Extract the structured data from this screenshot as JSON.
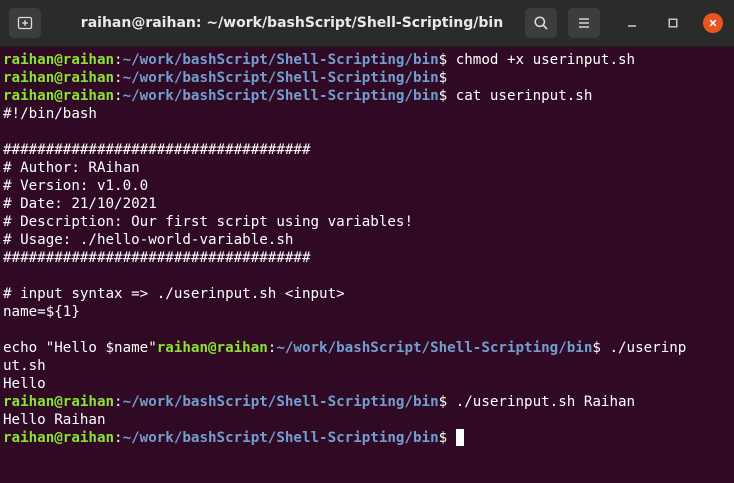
{
  "window": {
    "title": "raihan@raihan: ~/work/bashScript/Shell-Scripting/bin"
  },
  "prompt": {
    "user_host": "raihan@raihan",
    "colon": ":",
    "path": "~/work/bashScript/Shell-Scripting/bin",
    "symbol": "$"
  },
  "lines": [
    {
      "type": "prompt",
      "cmd": " chmod +x userinput.sh"
    },
    {
      "type": "prompt",
      "cmd": ""
    },
    {
      "type": "prompt",
      "cmd": " cat userinput.sh"
    },
    {
      "type": "text",
      "text": "#!/bin/bash"
    },
    {
      "type": "text",
      "text": ""
    },
    {
      "type": "text",
      "text": "####################################"
    },
    {
      "type": "text",
      "text": "# Author: RAihan"
    },
    {
      "type": "text",
      "text": "# Version: v1.0.0"
    },
    {
      "type": "text",
      "text": "# Date: 21/10/2021"
    },
    {
      "type": "text",
      "text": "# Description: Our first script using variables!"
    },
    {
      "type": "text",
      "text": "# Usage: ./hello-world-variable.sh"
    },
    {
      "type": "text",
      "text": "####################################"
    },
    {
      "type": "text",
      "text": ""
    },
    {
      "type": "text",
      "text": "# input syntax => ./userinput.sh <input>"
    },
    {
      "type": "text",
      "text": "name=${1}"
    },
    {
      "type": "text",
      "text": ""
    },
    {
      "type": "inline_prompt",
      "pre": "echo \"Hello $name\"",
      "cmd": " ./userinp"
    },
    {
      "type": "text",
      "text": "ut.sh"
    },
    {
      "type": "text",
      "text": "Hello"
    },
    {
      "type": "prompt",
      "cmd": " ./userinput.sh Raihan"
    },
    {
      "type": "text",
      "text": "Hello Raihan"
    },
    {
      "type": "prompt",
      "cmd": " ",
      "cursor": true
    }
  ]
}
